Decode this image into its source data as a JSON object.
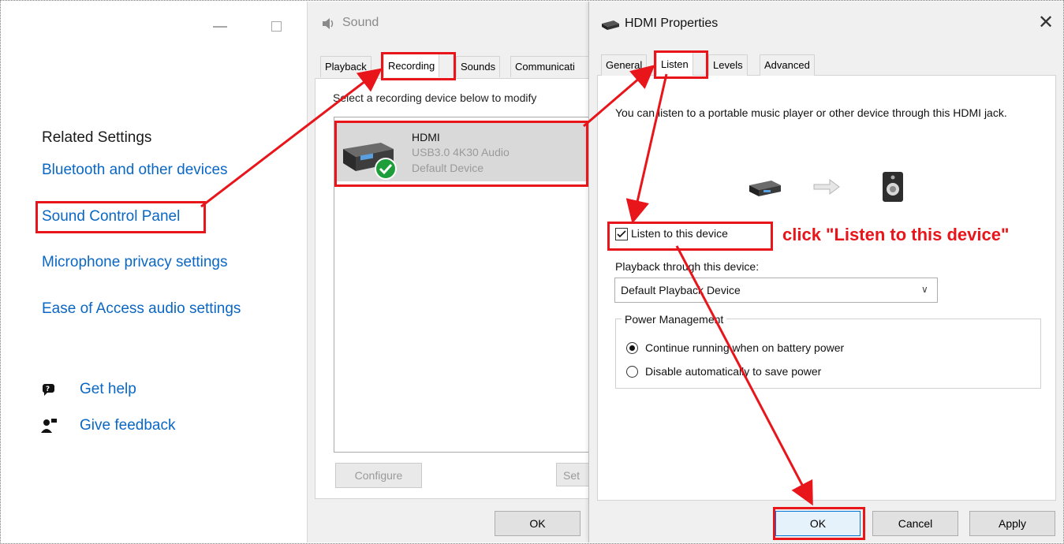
{
  "settings": {
    "related_heading": "Related Settings",
    "links": [
      "Bluetooth and other devices",
      "Sound Control Panel",
      "Microphone privacy settings",
      "Ease of Access audio settings"
    ],
    "help": {
      "get_help": "Get help",
      "give_feedback": "Give feedback"
    }
  },
  "sound_dialog": {
    "title": "Sound",
    "tabs": [
      "Playback",
      "Recording",
      "Sounds",
      "Communicati"
    ],
    "instruction": "Select a recording device below to modify",
    "device": {
      "name": "HDMI",
      "description": "USB3.0 4K30 Audio",
      "status": "Default Device"
    },
    "buttons": {
      "configure": "Configure",
      "set": "Set",
      "ok": "OK"
    }
  },
  "hdmi_dialog": {
    "title": "HDMI Properties",
    "tabs": [
      "General",
      "Listen",
      "Levels",
      "Advanced"
    ],
    "description": "You can listen to a portable music player or other device through this HDMI jack.",
    "listen_checkbox": {
      "label": "Listen to this device",
      "checked": true
    },
    "playback_label": "Playback through this device:",
    "playback_device": "Default Playback Device",
    "power_group_title": "Power Management",
    "power_options": [
      {
        "label": "Continue running when on battery power",
        "selected": true
      },
      {
        "label": "Disable automatically to save power",
        "selected": false
      }
    ],
    "buttons": {
      "ok": "OK",
      "cancel": "Cancel",
      "apply": "Apply"
    }
  },
  "annotation": {
    "callout": "click \"Listen to this device\"",
    "color": "#e8151b"
  },
  "colors": {
    "link": "#0a67c4",
    "device_check": "#1e9e3a"
  }
}
